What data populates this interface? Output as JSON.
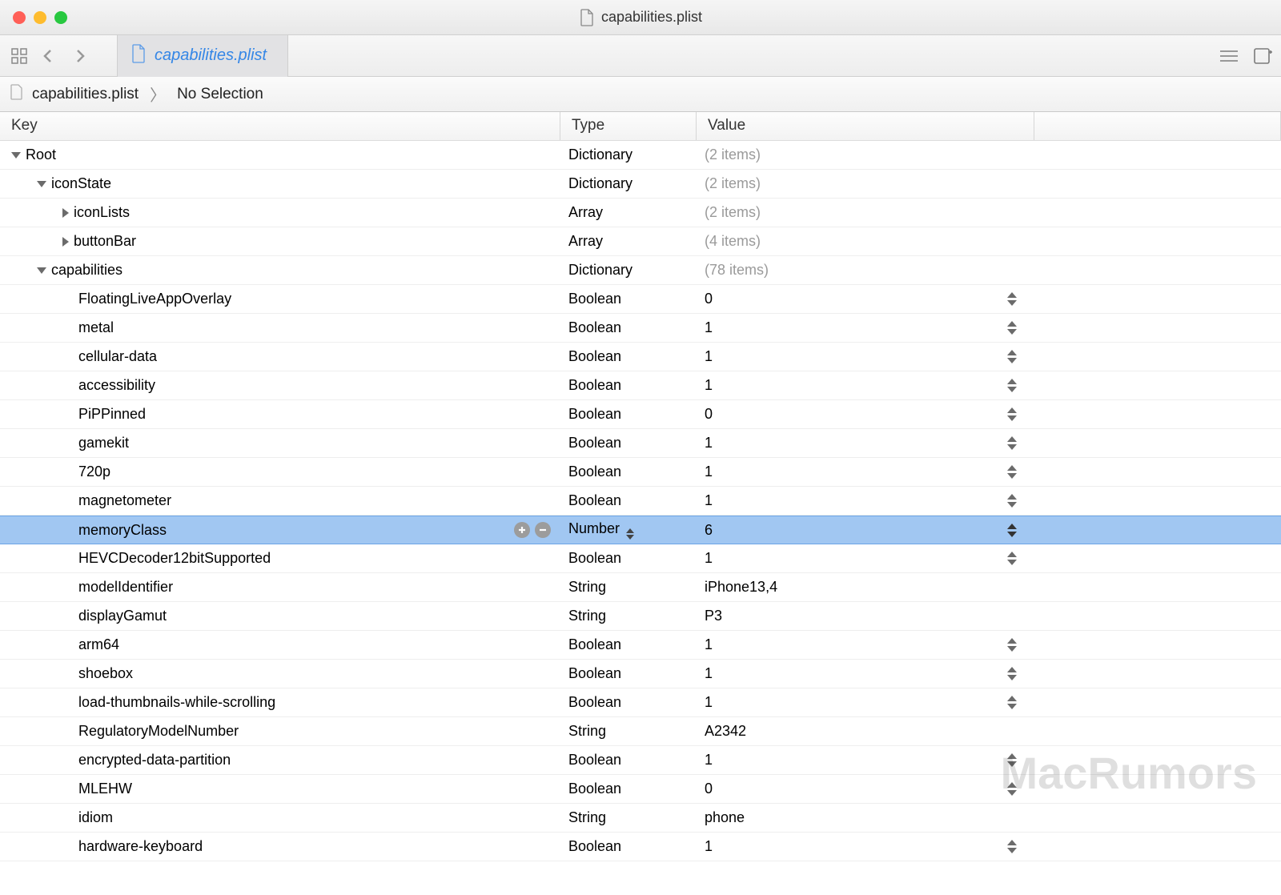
{
  "window": {
    "title": "capabilities.plist"
  },
  "tab": {
    "label": "capabilities.plist"
  },
  "breadcrumb": {
    "file": "capabilities.plist",
    "selection": "No Selection"
  },
  "headers": {
    "key": "Key",
    "type": "Type",
    "value": "Value"
  },
  "rows": [
    {
      "key": "Root",
      "indent": 0,
      "disclosure": "down",
      "type": "Dictionary",
      "value": "(2 items)",
      "gray": true,
      "stepper": false,
      "selected": false
    },
    {
      "key": "iconState",
      "indent": 1,
      "disclosure": "down",
      "type": "Dictionary",
      "value": "(2 items)",
      "gray": true,
      "stepper": false,
      "selected": false
    },
    {
      "key": "iconLists",
      "indent": 2,
      "disclosure": "right",
      "type": "Array",
      "value": "(2 items)",
      "gray": true,
      "stepper": false,
      "selected": false
    },
    {
      "key": "buttonBar",
      "indent": 2,
      "disclosure": "right",
      "type": "Array",
      "value": "(4 items)",
      "gray": true,
      "stepper": false,
      "selected": false
    },
    {
      "key": "capabilities",
      "indent": 1,
      "disclosure": "down",
      "type": "Dictionary",
      "value": "(78 items)",
      "gray": true,
      "stepper": false,
      "selected": false
    },
    {
      "key": "FloatingLiveAppOverlay",
      "indent": 2,
      "disclosure": "none",
      "type": "Boolean",
      "value": "0",
      "gray": false,
      "stepper": true,
      "selected": false
    },
    {
      "key": "metal",
      "indent": 2,
      "disclosure": "none",
      "type": "Boolean",
      "value": "1",
      "gray": false,
      "stepper": true,
      "selected": false
    },
    {
      "key": "cellular-data",
      "indent": 2,
      "disclosure": "none",
      "type": "Boolean",
      "value": "1",
      "gray": false,
      "stepper": true,
      "selected": false
    },
    {
      "key": "accessibility",
      "indent": 2,
      "disclosure": "none",
      "type": "Boolean",
      "value": "1",
      "gray": false,
      "stepper": true,
      "selected": false
    },
    {
      "key": "PiPPinned",
      "indent": 2,
      "disclosure": "none",
      "type": "Boolean",
      "value": "0",
      "gray": false,
      "stepper": true,
      "selected": false
    },
    {
      "key": "gamekit",
      "indent": 2,
      "disclosure": "none",
      "type": "Boolean",
      "value": "1",
      "gray": false,
      "stepper": true,
      "selected": false
    },
    {
      "key": "720p",
      "indent": 2,
      "disclosure": "none",
      "type": "Boolean",
      "value": "1",
      "gray": false,
      "stepper": true,
      "selected": false
    },
    {
      "key": "magnetometer",
      "indent": 2,
      "disclosure": "none",
      "type": "Boolean",
      "value": "1",
      "gray": false,
      "stepper": true,
      "selected": false
    },
    {
      "key": "memoryClass",
      "indent": 2,
      "disclosure": "none",
      "type": "Number",
      "value": "6",
      "gray": false,
      "stepper": true,
      "selected": true,
      "typeStepper": true,
      "rowActions": true
    },
    {
      "key": "HEVCDecoder12bitSupported",
      "indent": 2,
      "disclosure": "none",
      "type": "Boolean",
      "value": "1",
      "gray": false,
      "stepper": true,
      "selected": false
    },
    {
      "key": "modelIdentifier",
      "indent": 2,
      "disclosure": "none",
      "type": "String",
      "value": "iPhone13,4",
      "gray": false,
      "stepper": false,
      "selected": false
    },
    {
      "key": "displayGamut",
      "indent": 2,
      "disclosure": "none",
      "type": "String",
      "value": "P3",
      "gray": false,
      "stepper": false,
      "selected": false
    },
    {
      "key": "arm64",
      "indent": 2,
      "disclosure": "none",
      "type": "Boolean",
      "value": "1",
      "gray": false,
      "stepper": true,
      "selected": false
    },
    {
      "key": "shoebox",
      "indent": 2,
      "disclosure": "none",
      "type": "Boolean",
      "value": "1",
      "gray": false,
      "stepper": true,
      "selected": false
    },
    {
      "key": "load-thumbnails-while-scrolling",
      "indent": 2,
      "disclosure": "none",
      "type": "Boolean",
      "value": "1",
      "gray": false,
      "stepper": true,
      "selected": false
    },
    {
      "key": "RegulatoryModelNumber",
      "indent": 2,
      "disclosure": "none",
      "type": "String",
      "value": "A2342",
      "gray": false,
      "stepper": false,
      "selected": false
    },
    {
      "key": "encrypted-data-partition",
      "indent": 2,
      "disclosure": "none",
      "type": "Boolean",
      "value": "1",
      "gray": false,
      "stepper": true,
      "selected": false
    },
    {
      "key": "MLEHW",
      "indent": 2,
      "disclosure": "none",
      "type": "Boolean",
      "value": "0",
      "gray": false,
      "stepper": true,
      "selected": false
    },
    {
      "key": "idiom",
      "indent": 2,
      "disclosure": "none",
      "type": "String",
      "value": "phone",
      "gray": false,
      "stepper": false,
      "selected": false
    },
    {
      "key": "hardware-keyboard",
      "indent": 2,
      "disclosure": "none",
      "type": "Boolean",
      "value": "1",
      "gray": false,
      "stepper": true,
      "selected": false
    }
  ],
  "watermark": "MacRumors"
}
